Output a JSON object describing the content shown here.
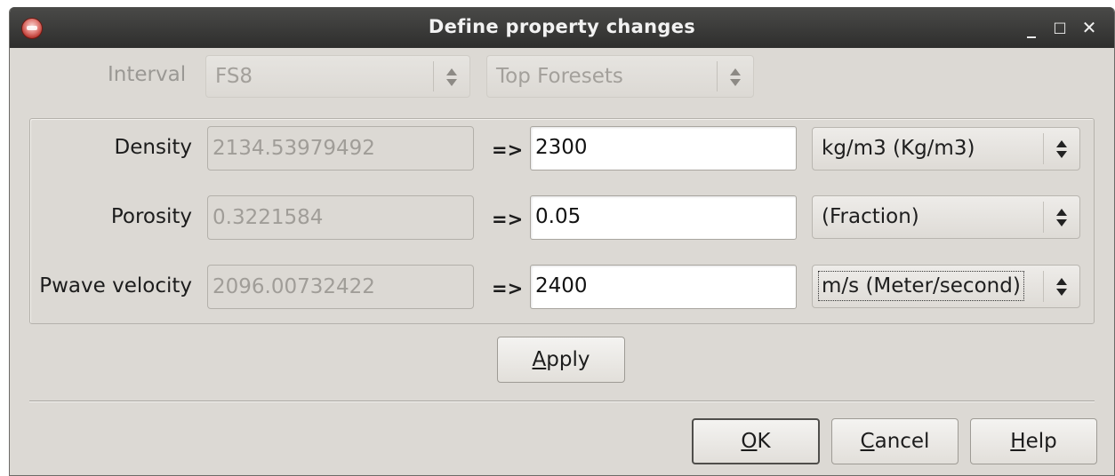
{
  "window": {
    "title": "Define property changes",
    "minimize_glyph": "_",
    "maximize_glyph": "□",
    "close_glyph": "✕"
  },
  "interval": {
    "label": "Interval",
    "from_value": "FS8",
    "to_value": "Top Foresets"
  },
  "rows": [
    {
      "label": "Density",
      "current": "2134.53979492",
      "arrow": "=>",
      "new_value": "2300",
      "unit": "kg/m3 (Kg/m3)"
    },
    {
      "label": "Porosity",
      "current": "0.3221584",
      "arrow": "=>",
      "new_value": "0.05",
      "unit": "(Fraction)"
    },
    {
      "label": "Pwave velocity",
      "current": "2096.00732422",
      "arrow": "=>",
      "new_value": "2400",
      "unit": "m/s (Meter/second)"
    }
  ],
  "buttons": {
    "apply_mnemonic": "A",
    "apply_rest": "pply",
    "ok_mnemonic": "O",
    "ok_rest": "K",
    "cancel_mnemonic": "C",
    "cancel_rest": "ancel",
    "help_mnemonic": "H",
    "help_rest": "elp"
  }
}
